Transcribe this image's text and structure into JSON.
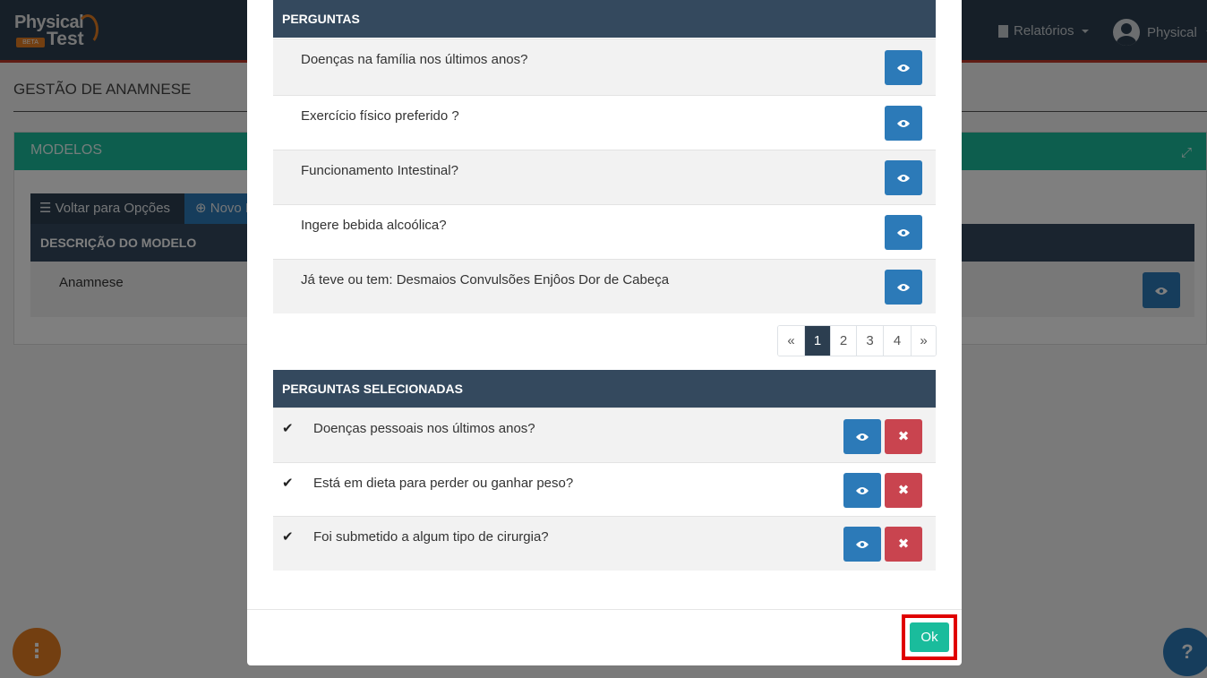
{
  "app": {
    "logo_line1": "Physical",
    "logo_line2": "Test",
    "logo_badge": "BETA"
  },
  "topnav": {
    "reports_label": "Relatórios",
    "user_label": "Physical"
  },
  "page": {
    "title": "GESTÃO DE ANAMNESE",
    "panel_title": "MODELOS",
    "back_button": "Voltar para Opções",
    "new_button": "Novo M",
    "table_header": "DESCRIÇÃO DO MODELO",
    "table_rows": [
      "Anamnese"
    ]
  },
  "fabs": {
    "left_symbol": "⋮",
    "right_symbol": "?"
  },
  "modal": {
    "questions_header": "PERGUNTAS",
    "questions": [
      "Doenças na família nos últimos anos?",
      "Exercício físico preferido ?",
      "Funcionamento Intestinal?",
      "Ingere bebida alcoólica?",
      "Já teve ou tem: Desmaios Convulsões Enjôos Dor de Cabeça"
    ],
    "pagination": [
      "«",
      "1",
      "2",
      "3",
      "4",
      "»"
    ],
    "pagination_active": "1",
    "selected_header": "PERGUNTAS SELECIONADAS",
    "selected_questions": [
      "Doenças pessoais nos últimos anos?",
      "Está em dieta para perder ou ganhar peso?",
      "Foi submetido a algum tipo de cirurgia?"
    ],
    "ok_label": "Ok"
  },
  "icons": {
    "view": "eye-icon",
    "remove": "times-icon",
    "selected": "check-icon",
    "menu": "bars-icon",
    "add": "plus-circle-icon",
    "expand": "expand-icon",
    "reports": "file-icon"
  },
  "colors": {
    "navbar": "#2c3e50",
    "accent_teal": "#1abc9c",
    "primary_blue": "#2c7ab8",
    "danger_red": "#c9444f",
    "header_dark": "#34495e",
    "highlight_frame": "#e00000"
  }
}
